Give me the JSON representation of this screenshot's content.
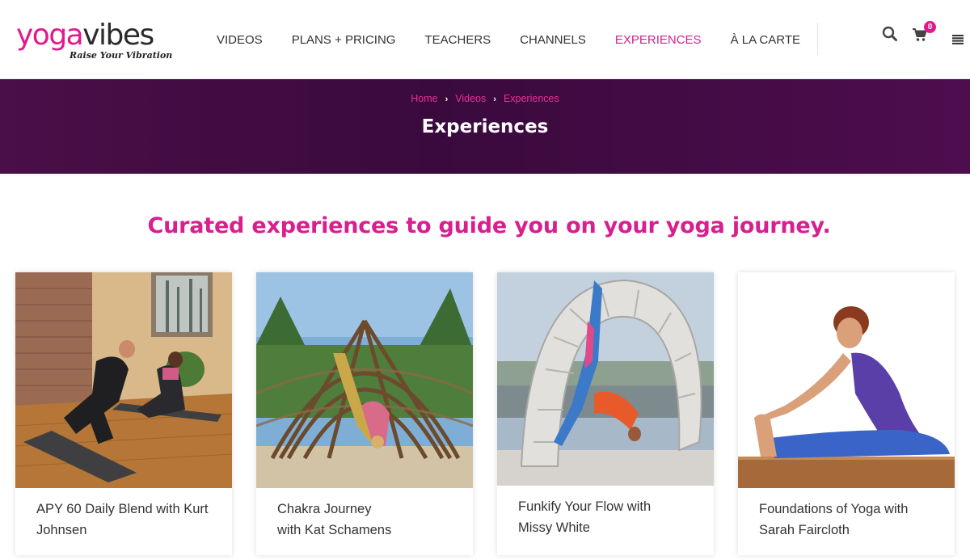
{
  "brand": {
    "logo_part1": "yoga",
    "logo_part2": "vibes",
    "tagline": "Raise Your Vibration",
    "accent_color": "#e2198d",
    "banner_color": "#3f0c40"
  },
  "nav": {
    "items": [
      {
        "label": "VIDEOS",
        "active": false
      },
      {
        "label": "PLANS + PRICING",
        "active": false
      },
      {
        "label": "TEACHERS",
        "active": false
      },
      {
        "label": "CHANNELS",
        "active": false
      },
      {
        "label": "EXPERIENCES",
        "active": true
      },
      {
        "label": "À LA CARTE",
        "active": false
      }
    ],
    "icons": [
      "search-icon",
      "cart-icon",
      "menu-icon"
    ],
    "cart_count": "0"
  },
  "banner": {
    "breadcrumb": [
      "Home",
      "Videos",
      "Experiences"
    ],
    "title": "Experiences"
  },
  "main": {
    "headline": "Curated experiences to guide you on your yoga journey.",
    "cards": [
      {
        "line1": "APY 60 Daily Blend with Kurt",
        "line2": "Johnsen"
      },
      {
        "line1": "Chakra Journey",
        "line2": "with Kat Schamens"
      },
      {
        "line1": "Funkify Your Flow with",
        "line2": "Missy White"
      },
      {
        "line1": "Foundations of Yoga with",
        "line2": "Sarah Faircloth"
      }
    ]
  }
}
